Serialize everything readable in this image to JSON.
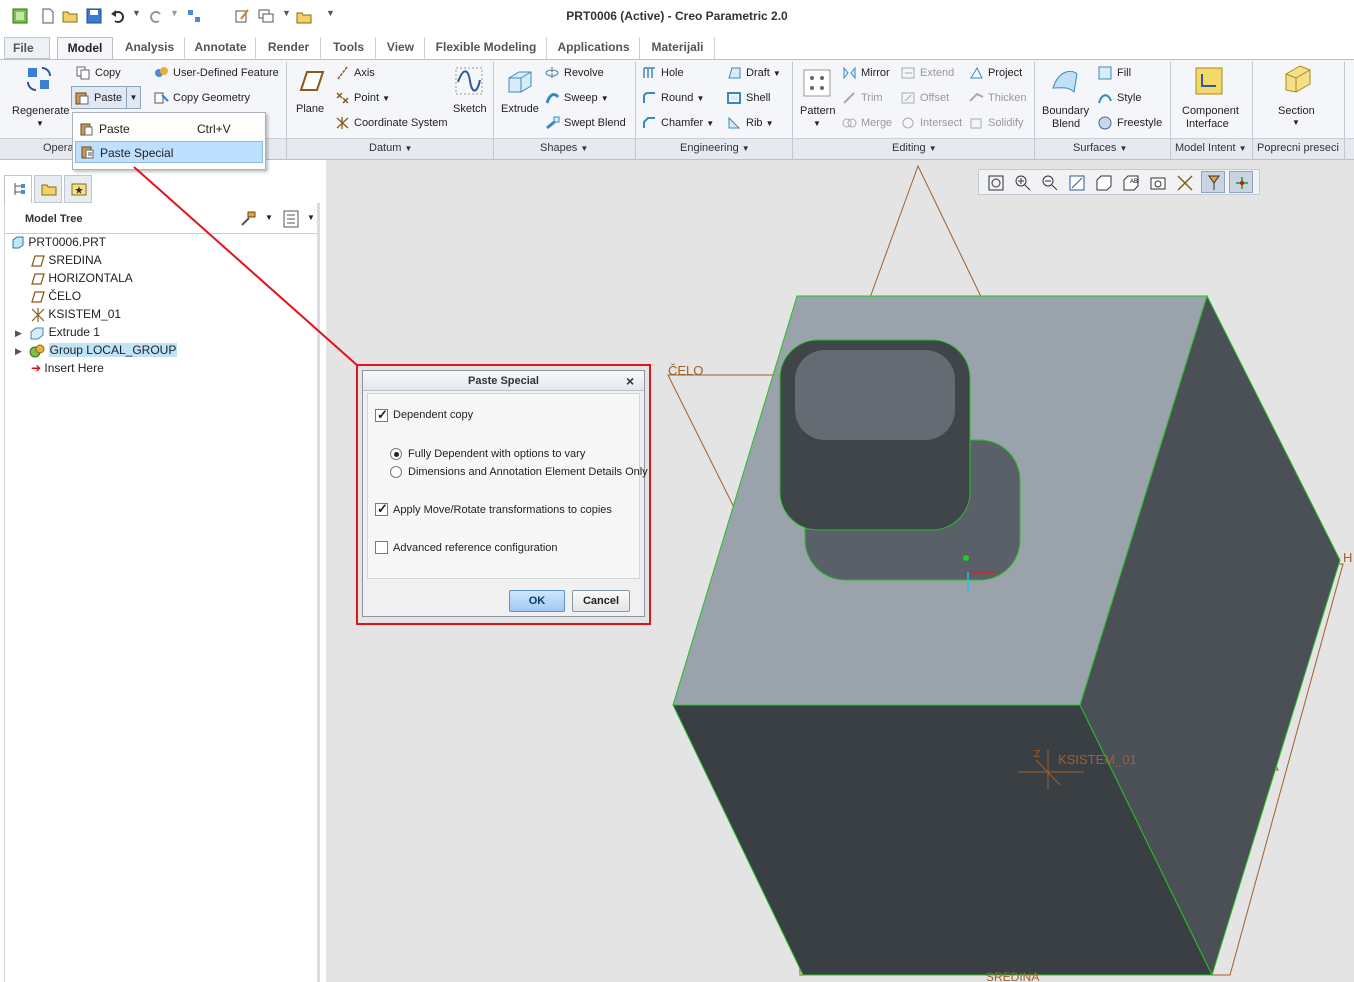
{
  "app": {
    "title": "PRT0006 (Active) - Creo Parametric 2.0"
  },
  "tabs": [
    "File",
    "Model",
    "Analysis",
    "Annotate",
    "Render",
    "Tools",
    "View",
    "Flexible Modeling",
    "Applications",
    "Materijali"
  ],
  "ribbon": {
    "operations": {
      "regenerate": "Regenerate",
      "copy": "Copy",
      "paste": "Paste",
      "udf": "User-Defined Feature",
      "copy_geometry": "Copy Geometry",
      "group_label": "Opera"
    },
    "datum": {
      "plane": "Plane",
      "axis": "Axis",
      "point": "Point",
      "csys": "Coordinate System",
      "sketch": "Sketch",
      "group_label": "Datum"
    },
    "shapes": {
      "extrude": "Extrude",
      "revolve": "Revolve",
      "sweep": "Sweep",
      "swept_blend": "Swept Blend",
      "group_label": "Shapes"
    },
    "engineering": {
      "hole": "Hole",
      "round": "Round",
      "chamfer": "Chamfer",
      "draft": "Draft",
      "shell": "Shell",
      "rib": "Rib",
      "group_label": "Engineering"
    },
    "editing": {
      "pattern": "Pattern",
      "mirror": "Mirror",
      "trim": "Trim",
      "merge": "Merge",
      "extend": "Extend",
      "offset": "Offset",
      "intersect": "Intersect",
      "project": "Project",
      "thicken": "Thicken",
      "solidify": "Solidify",
      "group_label": "Editing"
    },
    "surfaces": {
      "boundary_blend_1": "Boundary",
      "boundary_blend_2": "Blend",
      "fill": "Fill",
      "style": "Style",
      "freestyle": "Freestyle",
      "group_label": "Surfaces"
    },
    "model_intent": {
      "comp_if_1": "Component",
      "comp_if_2": "Interface",
      "group_label": "Model Intent"
    },
    "sections": {
      "section": "Section",
      "group_label": "Poprecni preseci"
    }
  },
  "paste_menu": {
    "paste": "Paste",
    "paste_shortcut": "Ctrl+V",
    "paste_special": "Paste Special"
  },
  "model_tree": {
    "header": "Model Tree",
    "items": [
      {
        "label": "PRT0006.PRT"
      },
      {
        "label": "SREDINA"
      },
      {
        "label": "HORIZONTALA"
      },
      {
        "label": "ČELO"
      },
      {
        "label": "KSISTEM_01"
      },
      {
        "label": "Extrude 1"
      },
      {
        "label": "Group LOCAL_GROUP"
      },
      {
        "label": "Insert Here"
      }
    ]
  },
  "dialog": {
    "title": "Paste Special",
    "dependent_copy": "Dependent copy",
    "opt_fully": "Fully Dependent with options to vary",
    "opt_dims": "Dimensions and Annotation Element Details Only",
    "apply_transform": "Apply Move/Rotate transformations to copies",
    "advanced": "Advanced reference configuration",
    "ok": "OK",
    "cancel": "Cancel"
  },
  "viewport": {
    "label_celo": "ČELO",
    "label_ksistem": "KSISTEM_01",
    "label_h": "H",
    "label_z": "Z",
    "label_sredina": "SREDINA"
  },
  "colors": {
    "accent_red": "#e0151b",
    "selection_blue": "#bfdfff",
    "datum_brown": "#a0602a",
    "edge_green": "#22cc22"
  }
}
